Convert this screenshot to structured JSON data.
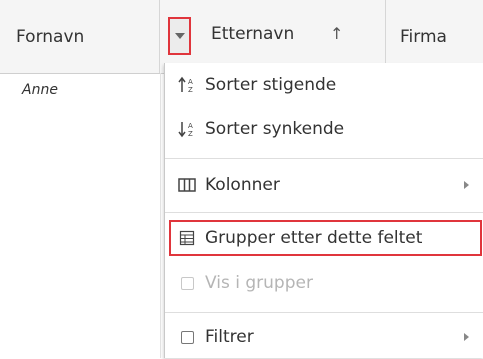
{
  "header": {
    "col_fornavn": "Fornavn",
    "col_etternavn": "Etternavn",
    "sort_indicator": "↑",
    "col_firma": "Firma"
  },
  "rows": [
    {
      "fornavn": "Anne"
    }
  ],
  "menu": {
    "sort_asc": "Sorter stigende",
    "sort_desc": "Sorter synkende",
    "columns": "Kolonner",
    "group_by": "Grupper etter dette feltet",
    "show_in_groups": "Vis i grupper",
    "filter": "Filtrer"
  },
  "colors": {
    "highlight_red": "#e0353c",
    "header_bg": "#f5f5f5"
  },
  "icons": {
    "trigger": "chevron-down-icon",
    "sort_asc": "sort-ascending-icon",
    "sort_desc": "sort-descending-icon",
    "columns": "columns-icon",
    "group": "group-table-icon",
    "checkbox": "checkbox-icon"
  }
}
